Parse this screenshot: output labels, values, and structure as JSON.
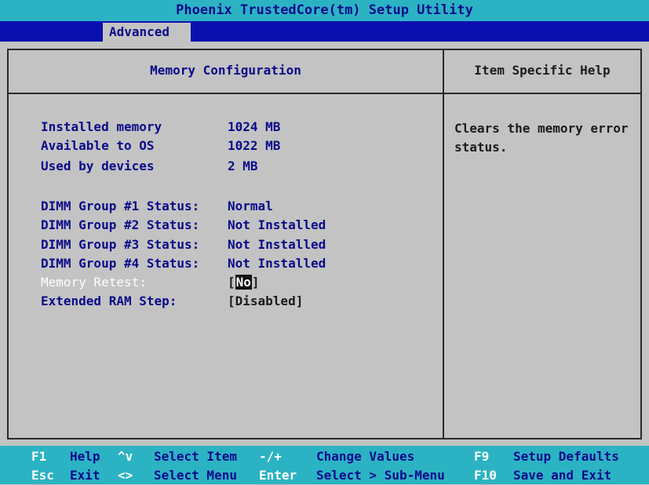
{
  "app": {
    "title": "Phoenix TrustedCore(tm) Setup Utility"
  },
  "menu": {
    "active_tab": "Advanced"
  },
  "left_panel": {
    "title": "Memory Configuration",
    "rows": [
      {
        "label": "Installed memory",
        "value": "1024 MB"
      },
      {
        "label": "Available to OS",
        "value": "1022 MB"
      },
      {
        "label": "Used by devices",
        "value": "2 MB"
      },
      {
        "label": "DIMM Group #1 Status:",
        "value": "Normal"
      },
      {
        "label": "DIMM Group #2 Status:",
        "value": "Not Installed"
      },
      {
        "label": "DIMM Group #3 Status:",
        "value": "Not Installed"
      },
      {
        "label": "DIMM Group #4 Status:",
        "value": "Not Installed"
      }
    ],
    "memory_retest": {
      "label": "Memory Retest:",
      "bracket_open": "[",
      "value": "No",
      "bracket_close": "]"
    },
    "extended_ram_step": {
      "label": "Extended RAM Step:",
      "value": "[Disabled]"
    }
  },
  "right_panel": {
    "title": "Item Specific Help",
    "help_text": "Clears the memory error status."
  },
  "footer": {
    "row1": [
      {
        "key": "F1",
        "desc": "Help"
      },
      {
        "key": "^v",
        "desc": "Select Item"
      },
      {
        "key": "-/+",
        "desc": "Change Values"
      },
      {
        "key": "F9",
        "desc": "Setup Defaults"
      }
    ],
    "row2": [
      {
        "key": "Esc",
        "desc": "Exit"
      },
      {
        "key": "<>",
        "desc": "Select Menu"
      },
      {
        "key": "Enter",
        "desc": "Select > Sub-Menu"
      },
      {
        "key": "F10",
        "desc": "Save and Exit"
      }
    ]
  },
  "colors": {
    "background": "#c3c3c3",
    "title_bar": "#2bb3c4",
    "menu_bar": "#0a10b0",
    "text_blue": "#0a0a8a",
    "key_white": "#ffffff"
  }
}
